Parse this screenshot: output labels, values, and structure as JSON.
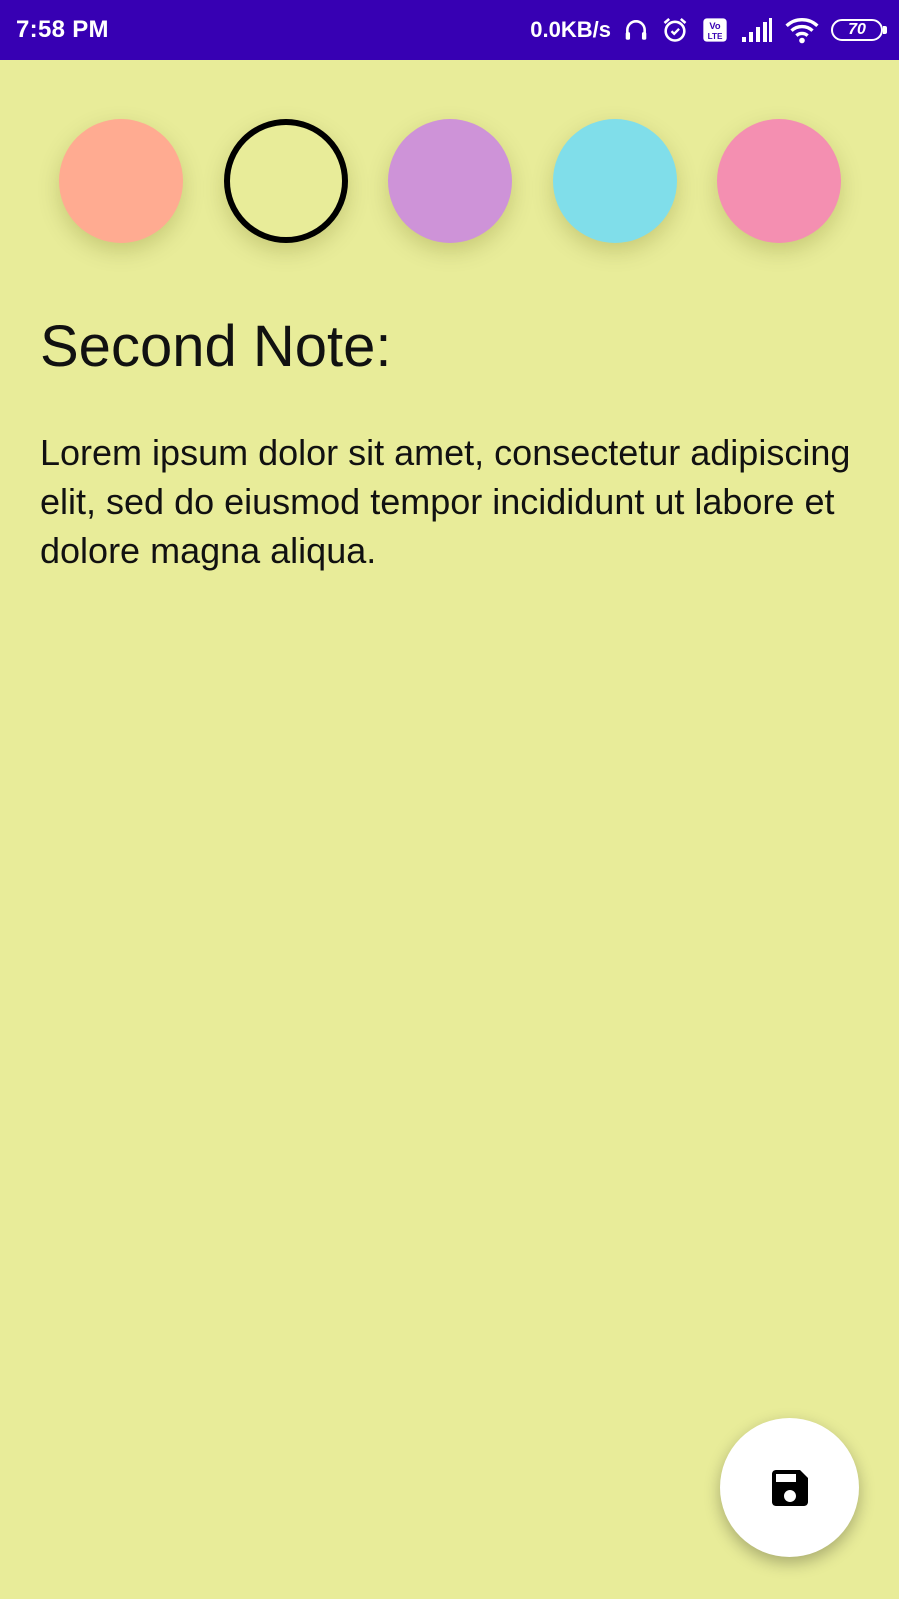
{
  "status_bar": {
    "time": "7:58 PM",
    "network_speed": "0.0KB/s",
    "battery_level": "70",
    "icons": [
      "headset-icon",
      "alarm-icon",
      "volte-icon",
      "signal-icon",
      "wifi-icon",
      "battery-icon"
    ],
    "background": "#3700b3"
  },
  "color_picker": {
    "swatches": [
      {
        "name": "salmon",
        "color": "#ffab91",
        "selected": false
      },
      {
        "name": "yellow",
        "color": "#e8ec99",
        "selected": true
      },
      {
        "name": "purple",
        "color": "#ce93d8",
        "selected": false
      },
      {
        "name": "cyan",
        "color": "#80deea",
        "selected": false
      },
      {
        "name": "pink",
        "color": "#f48fb1",
        "selected": false
      }
    ]
  },
  "note": {
    "title": "Second Note:",
    "body": "Lorem ipsum dolor sit amet, consectetur adipiscing elit, sed do eiusmod tempor incididunt ut labore et dolore magna aliqua.",
    "background": "#e8ec99"
  },
  "fab": {
    "icon": "save-icon"
  }
}
